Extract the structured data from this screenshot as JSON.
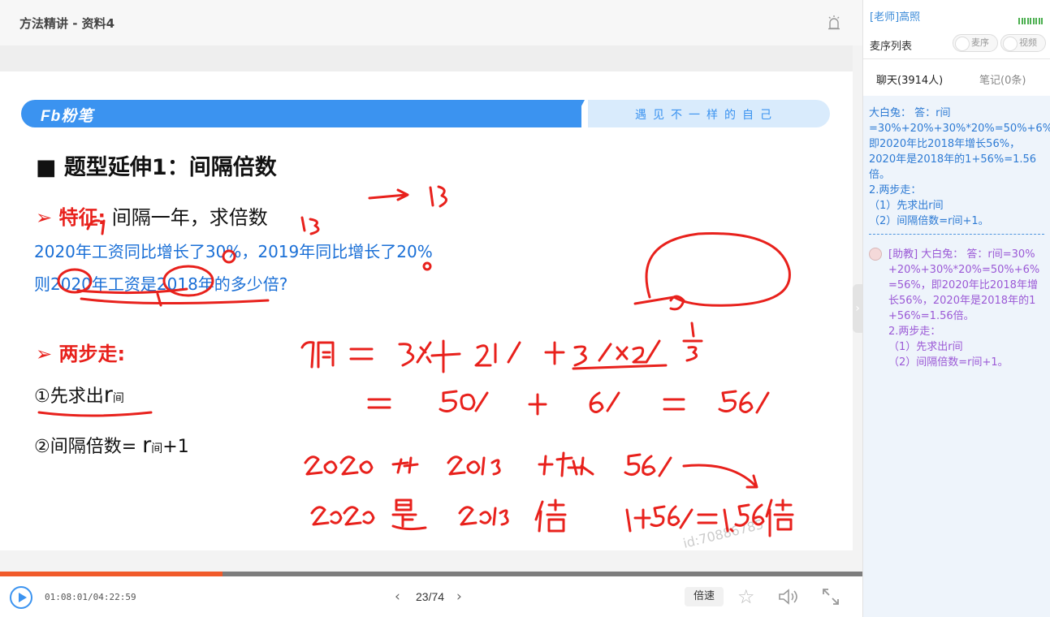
{
  "window": {
    "title": "方法精讲 - 资料4"
  },
  "slide": {
    "logo": "Fb粉笔",
    "slogan": "遇见不一样的自己",
    "heading": "■ 题型延伸1：间隔倍数",
    "feature_label": "➢ 特征:",
    "feature_text": "间隔一年，求倍数",
    "question_line1": "2020年工资同比增长了30%，2019年同比增长了20%",
    "question_line2": "则2020年工资是2018年的多少倍?",
    "twostep_label": "➢ 两步走:",
    "step1_prefix": "①先求出",
    "step1_r": "r",
    "step1_sub": "间",
    "step2_prefix": "②间隔倍数=",
    "step2_r": "r",
    "step2_sub": "间",
    "step2_suffix": "+1",
    "watermark": "id:70886785"
  },
  "controls": {
    "time": "01:08:01/04:22:59",
    "progress_fraction": 0.258,
    "page": "23/74",
    "speed_label": "倍速",
    "prev_icon": "chevron-left-icon",
    "next_icon": "chevron-right-icon"
  },
  "panel": {
    "teacher": "[老师]高照",
    "mic_title": "麦序列表",
    "toggle_mic": "麦序",
    "toggle_video": "视频",
    "tab_chat": "聊天(3914人)",
    "tab_notes": "笔记(0条)",
    "message1": [
      "大白兔： 答：r间",
      "=30%+20%+30%*20%=50%+6%",
      "即2020年比2018年增长56%，",
      "2020年是2018年的1+56%=1.56",
      "倍。",
      "2.两步走：",
      "（1）先求出r间",
      "（2）间隔倍数=r间+1。"
    ],
    "message2": [
      "[助教] 大白兔： 答：r间=30%",
      "+20%+30%*20%=50%+6%",
      "=56%，即2020年比2018年增",
      "长56%，2020年是2018年的1",
      "+56%=1.56倍。",
      "2.两步走：",
      "（1）先求出r间",
      "（2）间隔倍数=r间+1。"
    ]
  },
  "colors": {
    "accent": "#3b93f0",
    "ink": "#e8211c",
    "progress": "#f15a2a",
    "assistant": "#9b59d6"
  }
}
